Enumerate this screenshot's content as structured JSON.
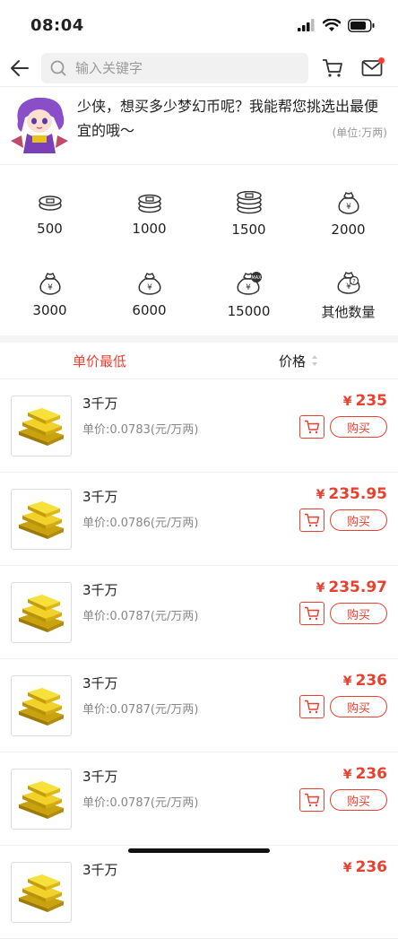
{
  "status": {
    "time": "08:04"
  },
  "search": {
    "placeholder": "输入关键字"
  },
  "intro": {
    "message": "少侠，想买多少梦幻币呢？我能帮您挑选出最便宜的哦～",
    "unit": "(单位:万两)"
  },
  "quantities": [
    {
      "label": "500",
      "icon": "coins-stack-icon"
    },
    {
      "label": "1000",
      "icon": "coins-stack-icon"
    },
    {
      "label": "1500",
      "icon": "coins-stack-icon"
    },
    {
      "label": "2000",
      "icon": "money-bag-icon"
    },
    {
      "label": "3000",
      "icon": "money-bag-icon"
    },
    {
      "label": "6000",
      "icon": "money-bag-icon"
    },
    {
      "label": "15000",
      "icon": "money-bag-max-icon"
    },
    {
      "label": "其他数量",
      "icon": "money-bag-question-icon"
    }
  ],
  "sort": {
    "lowest": "单价最低",
    "price": "价格"
  },
  "items": [
    {
      "title": "3千万",
      "unit_price": "单价:0.0783(元/万两)",
      "currency": "¥",
      "price": "235",
      "buy": "购买"
    },
    {
      "title": "3千万",
      "unit_price": "单价:0.0786(元/万两)",
      "currency": "¥",
      "price": "235.95",
      "buy": "购买"
    },
    {
      "title": "3千万",
      "unit_price": "单价:0.0787(元/万两)",
      "currency": "¥",
      "price": "235.97",
      "buy": "购买"
    },
    {
      "title": "3千万",
      "unit_price": "单价:0.0787(元/万两)",
      "currency": "¥",
      "price": "236",
      "buy": "购买"
    },
    {
      "title": "3千万",
      "unit_price": "单价:0.0787(元/万两)",
      "currency": "¥",
      "price": "236",
      "buy": "购买"
    },
    {
      "title": "3千万",
      "unit_price": "",
      "currency": "¥",
      "price": "236",
      "buy": ""
    }
  ],
  "colors": {
    "accent": "#e8412f",
    "gold": "#e8c21a"
  }
}
